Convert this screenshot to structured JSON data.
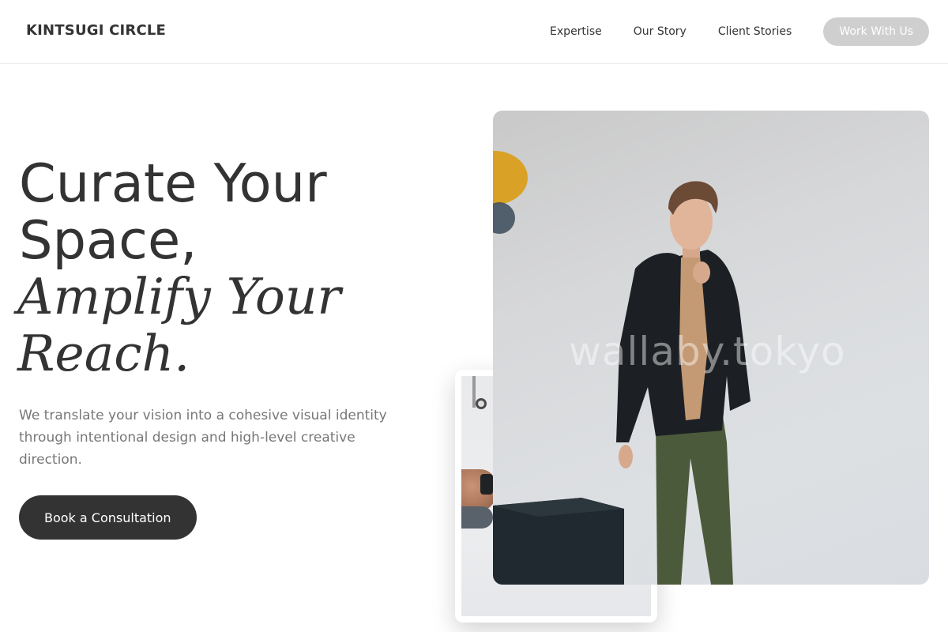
{
  "header": {
    "brand": "KINTSUGI CIRCLE",
    "nav": [
      {
        "label": "Expertise"
      },
      {
        "label": "Our Story"
      },
      {
        "label": "Client Stories"
      }
    ],
    "cta_label": "Work With Us"
  },
  "hero": {
    "title_line1": "Curate Your",
    "title_line2": "Space,",
    "title_line3": "Amplify Your",
    "title_line4": "Reach.",
    "subtitle": "We translate your vision into a cohesive visual identity through intentional design and high-level creative direction.",
    "cta_label": "Book a Consultation"
  },
  "media": {
    "main_photo_watermark": "wallaby.tokyo"
  },
  "colors": {
    "text": "#333333",
    "muted": "#777777",
    "primary_button": "#333333",
    "nav_button": "#cfcfcf",
    "background": "#ffffff"
  }
}
